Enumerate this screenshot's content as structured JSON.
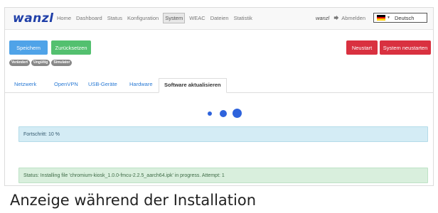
{
  "app": {
    "logo": "wanzl"
  },
  "nav": {
    "items": [
      {
        "label": "Home",
        "active": false
      },
      {
        "label": "Dashboard",
        "active": false
      },
      {
        "label": "Status",
        "active": false
      },
      {
        "label": "Konfiguration",
        "active": false
      },
      {
        "label": "System",
        "active": true
      },
      {
        "label": "WEAC",
        "active": false
      },
      {
        "label": "Dateien",
        "active": false
      },
      {
        "label": "Statistik",
        "active": false
      }
    ],
    "user": "wanzl",
    "logout_label": "Abmelden",
    "language": "Deutsch",
    "logout_icon": "logout-icon",
    "flag_icon": "german-flag-icon"
  },
  "actions": {
    "save_label": "Speichern",
    "reset_label": "Zurücksetzen",
    "restart_label": "Neustart",
    "system_restart_label": "System neustarten"
  },
  "badges": [
    "Verändert",
    "Ungültig",
    "Simulator"
  ],
  "tabs": [
    {
      "label": "Netzwerk",
      "active": false
    },
    {
      "label": "OpenVPN",
      "active": false
    },
    {
      "label": "USB-Geräte",
      "active": false
    },
    {
      "label": "Hardware",
      "active": false
    },
    {
      "label": "Software aktualisieren",
      "active": true
    }
  ],
  "progress": {
    "text": "Fortschritt: 10 %",
    "value_percent": 10
  },
  "status": {
    "text": "Status: Installing file 'chromium-kiosk_1.0.0-fmcu-2.2.5_aarch64.ipk' in progress. Attempt: 1"
  },
  "caption": "Anzeige während der Installation",
  "colors": {
    "primary": "#4fa3e8",
    "success": "#53c06f",
    "danger": "#d93140",
    "spinner": "#2e63dc",
    "logo": "#1f3fa8"
  }
}
